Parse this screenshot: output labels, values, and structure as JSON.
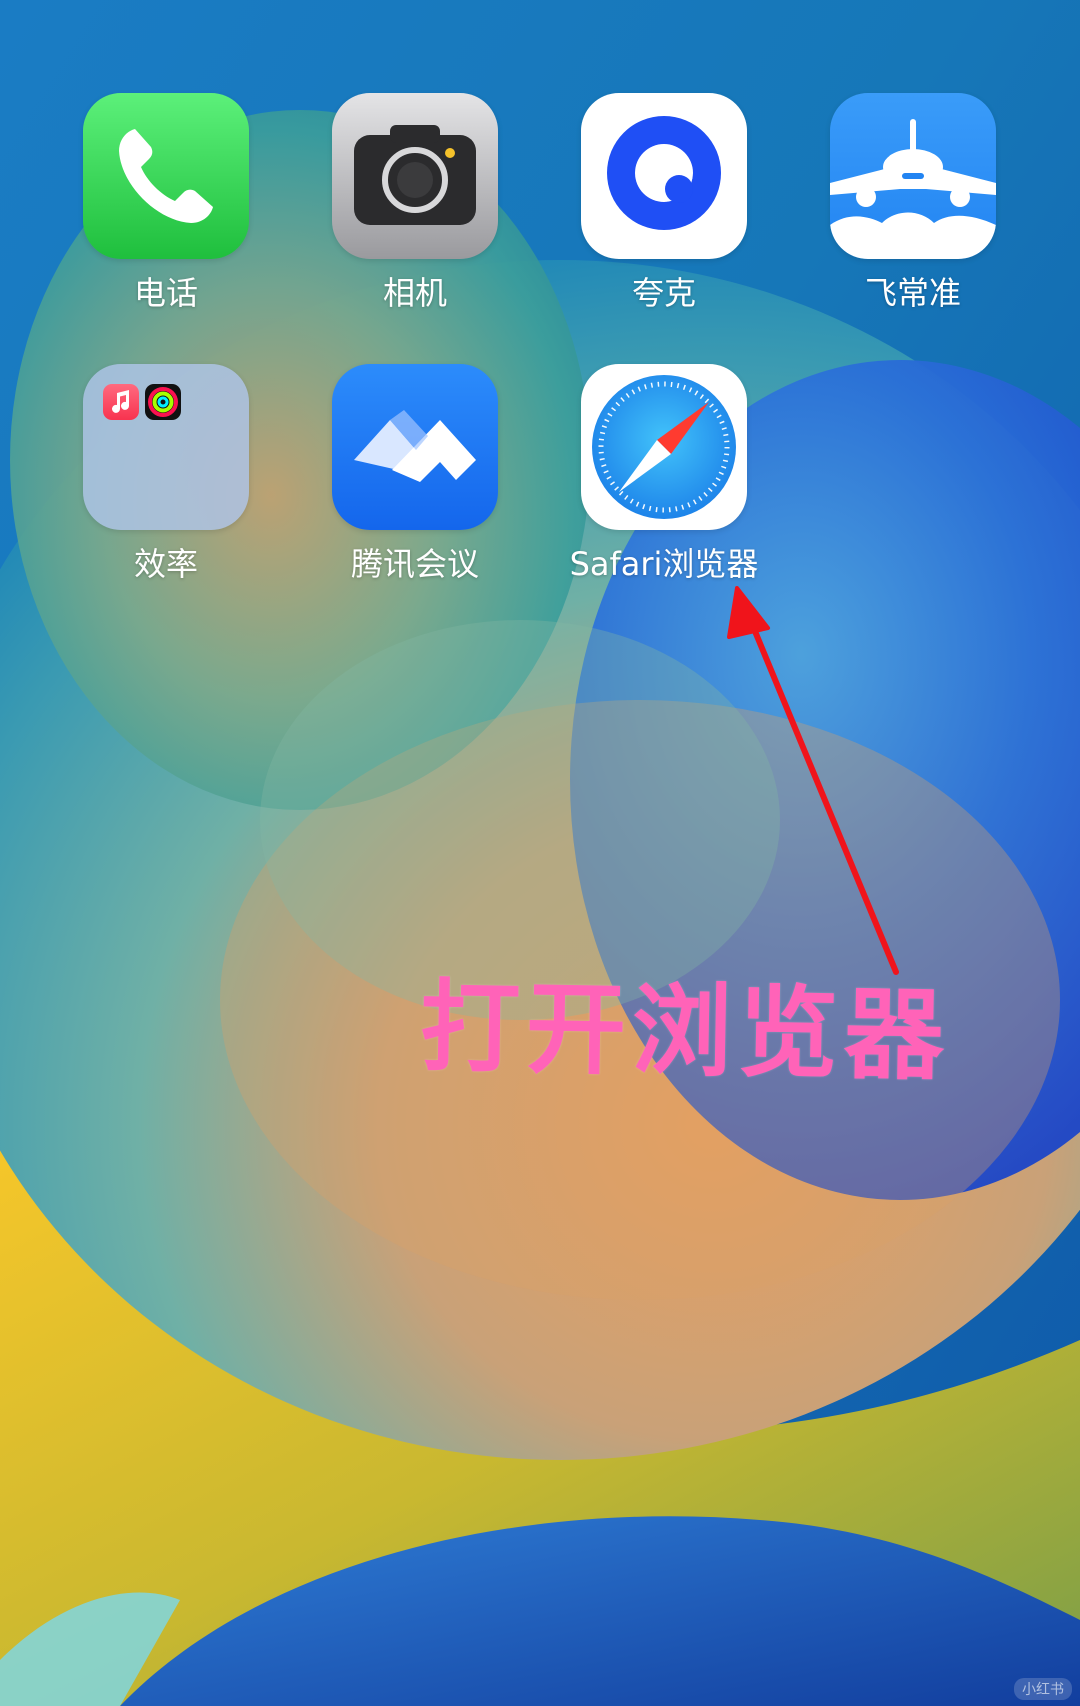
{
  "home_screen": {
    "apps": [
      {
        "label": "电话",
        "icon": "phone-icon",
        "color": "#34c759"
      },
      {
        "label": "相机",
        "icon": "camera-icon",
        "color": "#9a9a9c"
      },
      {
        "label": "夸克",
        "icon": "quark-icon",
        "color": "#1d4ff5"
      },
      {
        "label": "飞常准",
        "icon": "airplane-icon",
        "color": "#2d8cf7"
      },
      {
        "label": "效率",
        "icon": "folder-icon",
        "folder_apps": [
          "music-icon",
          "fitness-icon"
        ]
      },
      {
        "label": "腾讯会议",
        "icon": "tencent-meeting-icon",
        "color": "#1a73f2"
      },
      {
        "label": "Safari浏览器",
        "icon": "safari-compass-icon",
        "color": "#1f9cf0"
      }
    ]
  },
  "annotation": {
    "text": "打开浏览器",
    "color": "#ff63b8",
    "arrow_color": "#f0141b",
    "arrow_target": "Safari浏览器"
  },
  "watermark": "小红书"
}
